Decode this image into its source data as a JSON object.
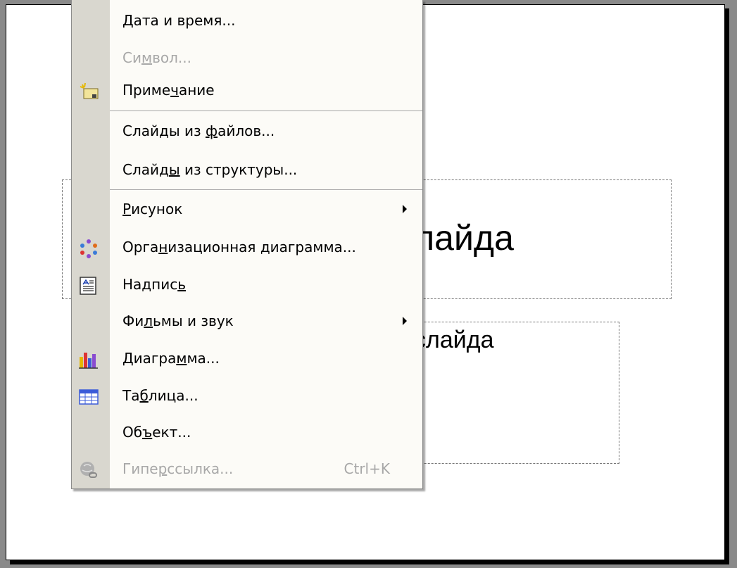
{
  "slide": {
    "title_text": "лайда",
    "subtitle_text": "слайда"
  },
  "menu": {
    "items": [
      {
        "label_pre": "",
        "label_u": "Д",
        "label_post": "ата и время...",
        "disabled": false,
        "icon": "none"
      },
      {
        "label_pre": "Си",
        "label_u": "м",
        "label_post": "вол...",
        "disabled": true,
        "icon": "none"
      },
      {
        "label_pre": "Приме",
        "label_u": "ч",
        "label_post": "ание",
        "disabled": false,
        "icon": "comment-icon"
      },
      {
        "label_pre": "Слайды из ",
        "label_u": "ф",
        "label_post": "айлов...",
        "disabled": false,
        "icon": "none"
      },
      {
        "label_pre": "Слайд",
        "label_u": "ы",
        "label_post": " из структуры...",
        "disabled": false,
        "icon": "none"
      },
      {
        "label_pre": "",
        "label_u": "Р",
        "label_post": "исунок",
        "disabled": false,
        "icon": "none",
        "submenu": true
      },
      {
        "label_pre": "Орга",
        "label_u": "н",
        "label_post": "изационная диаграмма...",
        "disabled": false,
        "icon": "org-chart-icon"
      },
      {
        "label_pre": "Надпис",
        "label_u": "ь",
        "label_post": "",
        "disabled": false,
        "icon": "text-box-icon"
      },
      {
        "label_pre": "Фи",
        "label_u": "л",
        "label_post": "ьмы и звук",
        "disabled": false,
        "icon": "none",
        "submenu": true
      },
      {
        "label_pre": "Диагра",
        "label_u": "м",
        "label_post": "ма...",
        "disabled": false,
        "icon": "chart-icon"
      },
      {
        "label_pre": "Та",
        "label_u": "б",
        "label_post": "лица...",
        "disabled": false,
        "icon": "table-icon"
      },
      {
        "label_pre": "Об",
        "label_u": "ъ",
        "label_post": "ект...",
        "disabled": false,
        "icon": "none"
      },
      {
        "label_pre": "Гипе",
        "label_u": "р",
        "label_post": "ссылка...",
        "disabled": true,
        "icon": "hyperlink-icon",
        "shortcut": "Ctrl+K"
      }
    ]
  },
  "colors": {
    "menu_bg": "#fcfbf7",
    "gutter": "#d9d7cf",
    "disabled_text": "#a8a8a8"
  }
}
